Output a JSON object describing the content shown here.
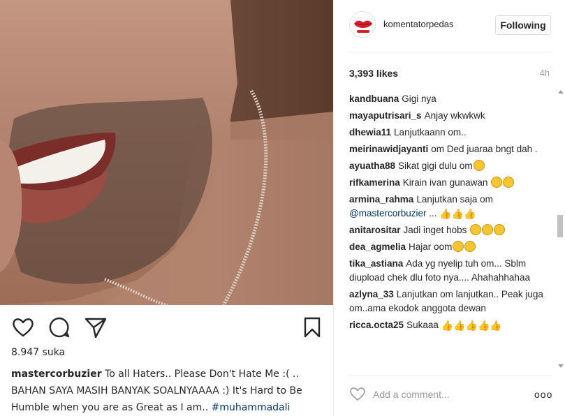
{
  "post": {
    "likes_left": "8.947 suka",
    "caption_user": "mastercorbuzier",
    "caption_text": " To all Haters.. Please Don't Hate Me :( .. BAHAN SAYA MASIH BANYAK SOALNYAAAA :) It's Hard to Be Humble when you are as Great as I am.. ",
    "caption_tag": "#muhammadali"
  },
  "header": {
    "username": "komentatorpedas",
    "follow_label": "Following"
  },
  "stats": {
    "likes": "3,393 likes",
    "time": "4h"
  },
  "comments": [
    {
      "user": "kandbuana",
      "text": "Gigi nya"
    },
    {
      "user": "mayaputrisari_s",
      "text": "Anjay wkwkwk"
    },
    {
      "user": "dhewia11",
      "text": "Lanjutkaann om.."
    },
    {
      "user": "meirinawidjayanti",
      "text": "om Ded juaraa bngt dah ."
    },
    {
      "user": "ayuatha88",
      "text": "Sikat gigi dulu om"
    },
    {
      "user": "rifkamerina",
      "text": "Kirain ivan gunawan"
    },
    {
      "user": "armina_rahma",
      "text": "Lanjutkan saja om",
      "mention": "@mastercorbuzier",
      "after": " ..."
    },
    {
      "user": "anitarositar",
      "text": "Jadi inget hobs"
    },
    {
      "user": "dea_agmelia",
      "text": "Hajar oom"
    },
    {
      "user": "tika_astiana",
      "text": "Ada yg nyelip tuh om... Sblm diupload chek dlu foto nya.... Ahahahhahaa"
    },
    {
      "user": "azlyna_33",
      "text": "Lanjutkan om lanjutkan.. Peak juga om..ama ekodok anggota dewan"
    },
    {
      "user": "ricca.octa25",
      "text": "Sukaaa"
    }
  ],
  "footer": {
    "comment_placeholder": "Add a comment...",
    "more_label": "ooo"
  },
  "icons": {
    "like": "heart-icon",
    "comment": "comment-bubble-icon",
    "share": "paper-plane-icon",
    "save": "bookmark-icon",
    "comment_like": "heart-outline-icon"
  },
  "colors": {
    "link": "#003569",
    "text": "#262626",
    "muted": "#999999"
  }
}
